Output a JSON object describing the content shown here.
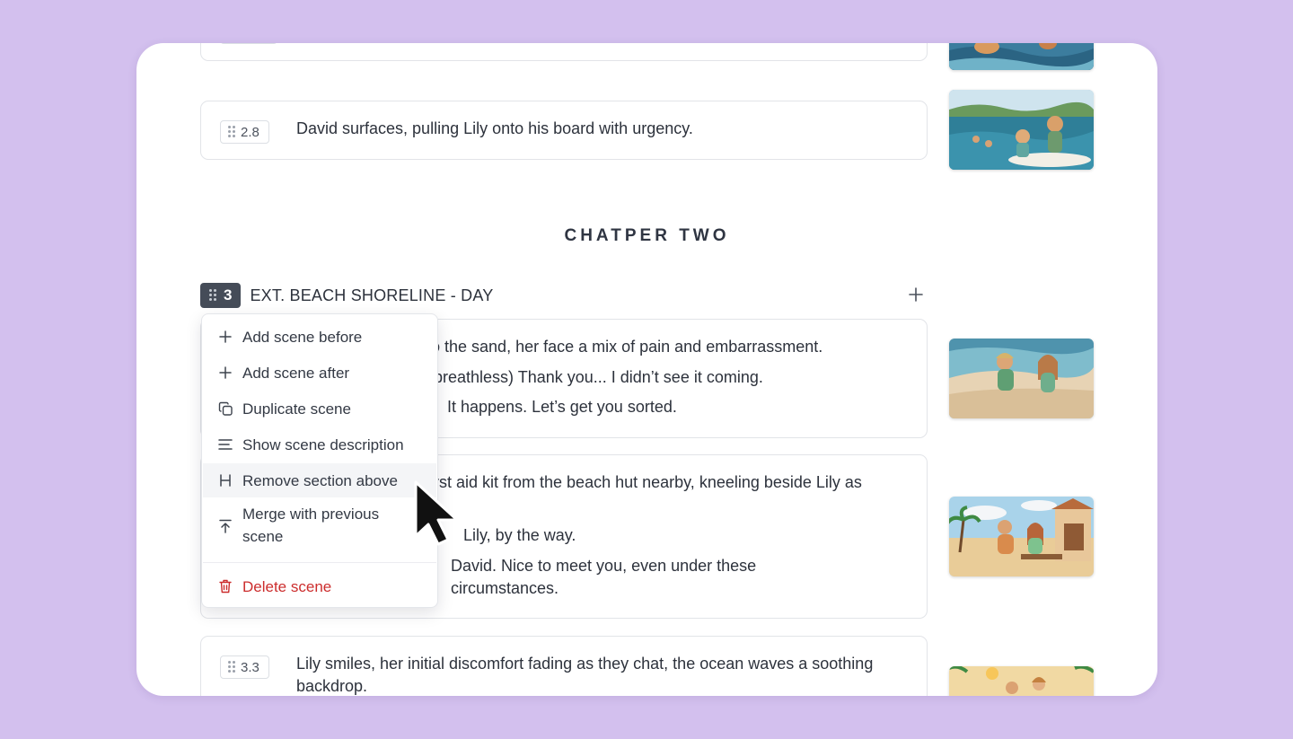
{
  "cards": {
    "top_partial": {},
    "scene_2_8": {
      "number": "2.8",
      "text": "David surfaces, pulling Lily onto his board with urgency."
    },
    "scene_3_1": {
      "lines": [
        "to the sand, her face a mix of pain and embarrassment.",
        "breathless) Thank you... I didn’t see it coming.",
        "It happens. Let’s get you sorted."
      ]
    },
    "scene_3_2": {
      "lines": [
        "rst aid kit from the beach hut nearby, kneeling beside Lily as",
        "Lily, by the way.",
        "David. Nice to meet you, even under these",
        "circumstances."
      ]
    },
    "scene_3_3": {
      "number": "3.3",
      "line1": "Lily smiles, her initial discomfort fading as they chat, the ocean waves a soothing",
      "line2": "backdrop."
    }
  },
  "chapter": {
    "title": "CHATPER TWO"
  },
  "scene_header": {
    "number": "3",
    "title": "EXT. BEACH SHORELINE - DAY",
    "add_icon": "plus-icon"
  },
  "context_menu": {
    "items": [
      {
        "label": "Add scene before",
        "icon": "plus-icon"
      },
      {
        "label": "Add scene after",
        "icon": "plus-icon"
      },
      {
        "label": "Duplicate scene",
        "icon": "copy-icon"
      },
      {
        "label": "Show scene description",
        "icon": "align-left-icon"
      },
      {
        "label": "Remove section above",
        "icon": "heading-icon"
      },
      {
        "label_line1": "Merge with previous",
        "label_line2": "scene",
        "icon": "arrow-up-to-line-icon"
      },
      {
        "label": "Delete scene",
        "icon": "trash-icon"
      }
    ],
    "hovered_item": "Remove section above",
    "danger_color": "#cc2d2d"
  },
  "colors": {
    "background": "#d3c0ee",
    "panel": "#ffffff",
    "scene_badge": "#454c58"
  }
}
